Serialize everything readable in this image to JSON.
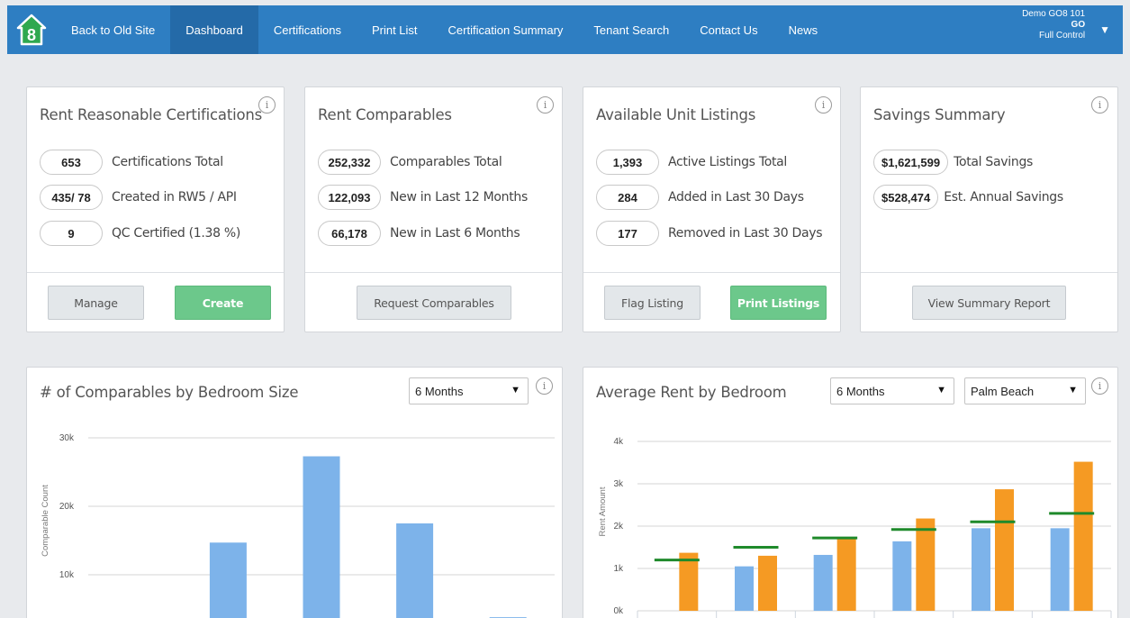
{
  "nav": {
    "items": [
      {
        "label": "Back to Old Site",
        "active": false
      },
      {
        "label": "Dashboard",
        "active": true
      },
      {
        "label": "Certifications",
        "active": false
      },
      {
        "label": "Print List",
        "active": false
      },
      {
        "label": "Certification Summary",
        "active": false
      },
      {
        "label": "Tenant Search",
        "active": false
      },
      {
        "label": "Contact Us",
        "active": false
      },
      {
        "label": "News",
        "active": false
      }
    ],
    "user": {
      "org": "Demo GO8 101",
      "code": "GO",
      "role": "Full Control",
      "caret": "▼"
    },
    "logo_text": "8"
  },
  "cards": {
    "rent_reasonable": {
      "title": "Rent Reasonable Certifications",
      "stats": [
        {
          "value": "653",
          "label": "Certifications Total"
        },
        {
          "value": "435/ 78",
          "label": "Created in RW5 / API"
        },
        {
          "value": "9",
          "label": "QC Certified (1.38 %)"
        }
      ],
      "buttons": {
        "manage": "Manage",
        "create": "Create"
      }
    },
    "rent_comparables": {
      "title": "Rent Comparables",
      "stats": [
        {
          "value": "252,332",
          "label": "Comparables Total"
        },
        {
          "value": "122,093",
          "label": "New in Last 12 Months"
        },
        {
          "value": "66,178",
          "label": "New in Last 6 Months"
        }
      ],
      "buttons": {
        "request": "Request Comparables"
      }
    },
    "unit_listings": {
      "title": "Available Unit Listings",
      "stats": [
        {
          "value": "1,393",
          "label": "Active Listings Total"
        },
        {
          "value": "284",
          "label": "Added in Last 30 Days"
        },
        {
          "value": "177",
          "label": "Removed in Last 30 Days"
        }
      ],
      "buttons": {
        "flag": "Flag Listing",
        "print": "Print Listings"
      }
    },
    "savings": {
      "title": "Savings Summary",
      "stats": [
        {
          "value": "$1,621,599",
          "label": "Total Savings"
        },
        {
          "value": "$528,474",
          "label": "Est. Annual Savings"
        }
      ],
      "buttons": {
        "report": "View Summary Report"
      }
    }
  },
  "info_glyph": "i",
  "charts": {
    "comparables": {
      "title": "# of Comparables by Bedroom Size",
      "period_select": "6 Months"
    },
    "avg_rent": {
      "title": "Average Rent by Bedroom",
      "period_select": "6 Months",
      "area_select": "Palm Beach"
    }
  },
  "chart_data": [
    {
      "type": "bar",
      "title": "# of Comparables by Bedroom Size",
      "ylabel": "Comparable Count",
      "ylim": [
        0,
        30000
      ],
      "ytick_labels": [
        "10k",
        "20k",
        "30k"
      ],
      "ytick_values": [
        10000,
        20000,
        30000
      ],
      "series": [
        {
          "color": "#7db3ea",
          "values": [
            0,
            14700,
            27300,
            17500,
            3800
          ]
        }
      ],
      "grid": true
    },
    {
      "type": "bar",
      "title": "Average Rent by Bedroom",
      "ylabel": "Rent Amount",
      "ylim": [
        0,
        4000
      ],
      "ytick_labels": [
        "0k",
        "1k",
        "2k",
        "3k",
        "4k"
      ],
      "ytick_values": [
        0,
        1000,
        2000,
        3000,
        4000
      ],
      "series": [
        {
          "color": "#7db3ea",
          "values": [
            0,
            1050,
            1320,
            1640,
            1950,
            1950
          ]
        },
        {
          "color": "#f59a23",
          "values": [
            1370,
            1300,
            1700,
            2180,
            2870,
            3520
          ]
        }
      ],
      "markers": {
        "color": "#1f8a2b",
        "values": [
          1200,
          1500,
          1720,
          1920,
          2100,
          2300
        ]
      },
      "grid": true
    }
  ]
}
